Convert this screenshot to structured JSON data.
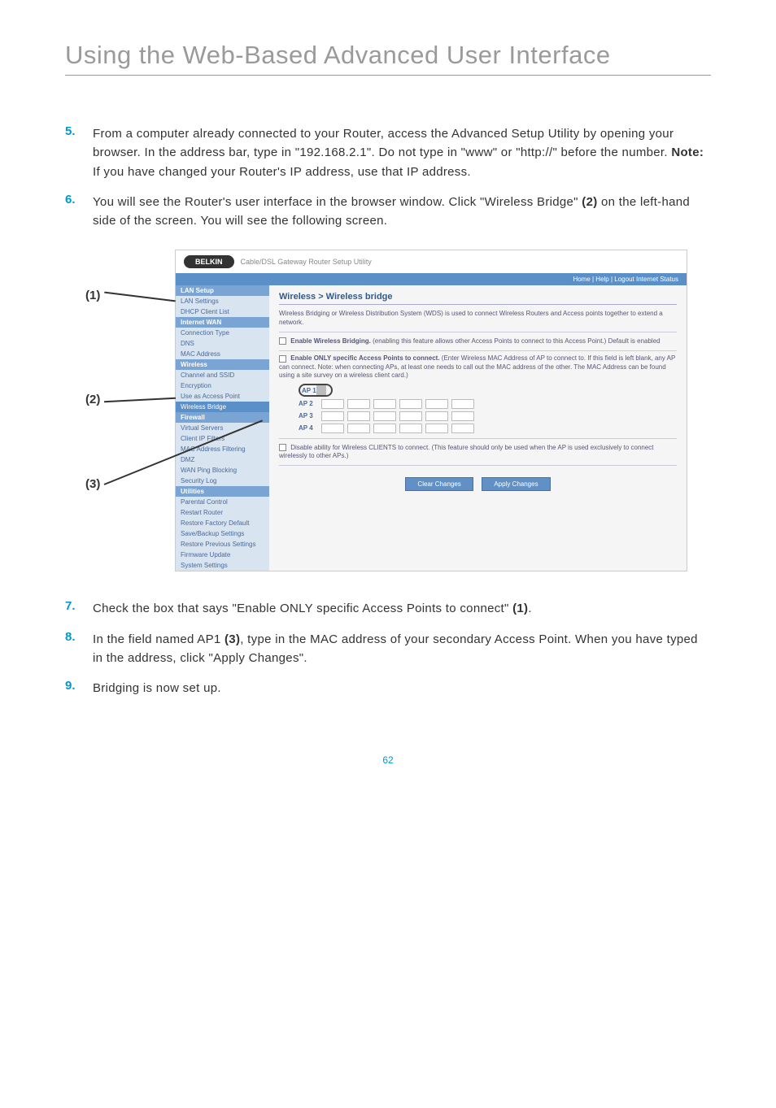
{
  "header": {
    "title": "Using the Web-Based Advanced User Interface"
  },
  "callouts": {
    "c1": "(1)",
    "c2": "(2)",
    "c3": "(3)"
  },
  "steps": {
    "s5": {
      "num": "5.",
      "text_a": "From a computer already connected to your Router, access the Advanced Setup Utility by opening your browser. In the address bar, type in \"192.168.2.1\". Do not type in \"www\" or \"http://\" before the number. ",
      "bold": "Note:",
      "text_b": " If you have changed your Router's IP address, use that IP address."
    },
    "s6": {
      "num": "6.",
      "text_a": "You will see the Router's user interface in the browser window. Click \"Wireless Bridge\" ",
      "bold": "(2)",
      "text_b": " on the left-hand side of the screen. You will see the following screen."
    },
    "s7": {
      "num": "7.",
      "text_a": "Check the box that says \"Enable ONLY specific Access Points to connect\" ",
      "bold": "(1)",
      "text_b": "."
    },
    "s8": {
      "num": "8.",
      "text_a": "In the field named AP1 ",
      "bold": "(3)",
      "text_b": ", type in the MAC address of your secondary Access Point. When you have typed in the address, click \"Apply Changes\"."
    },
    "s9": {
      "num": "9.",
      "text": "Bridging is now set up."
    }
  },
  "router": {
    "logo": "BELKIN",
    "subtitle": "Cable/DSL Gateway Router Setup Utility",
    "topbar": "Home | Help | Logout   Internet Status",
    "sidebar": {
      "h1": "LAN Setup",
      "i1": "LAN Settings",
      "i2": "DHCP Client List",
      "h2": "Internet WAN",
      "i3": "Connection Type",
      "i4": "DNS",
      "i5": "MAC Address",
      "h3": "Wireless",
      "i6": "Channel and SSID",
      "i7": "Encryption",
      "i8": "Use as Access Point",
      "i9": "Wireless Bridge",
      "h4": "Firewall",
      "i10": "Virtual Servers",
      "i11": "Client IP Filters",
      "i12": "MAC Address Filtering",
      "i13": "DMZ",
      "i14": "WAN Ping Blocking",
      "i15": "Security Log",
      "h5": "Utilities",
      "i16": "Parental Control",
      "i17": "Restart Router",
      "i18": "Restore Factory Default",
      "i19": "Save/Backup Settings",
      "i20": "Restore Previous Settings",
      "i21": "Firmware Update",
      "i22": "System Settings"
    },
    "content": {
      "title": "Wireless > Wireless bridge",
      "intro": "Wireless Bridging or Wireless Distribution System (WDS) is used to connect Wireless Routers and Access points together to extend a network.",
      "check1_bold": "Enable Wireless Bridging.",
      "check1_rest": " (enabling this feature allows other Access Points to connect to this Access Point.) Default is enabled",
      "check2_bold": "Enable ONLY specific Access Points to connect.",
      "check2_rest": " (Enter Wireless MAC Address of AP to connect to. If this field is left blank, any AP can connect. Note: when connecting APs, at least one needs to call out the MAC address of the other. The MAC Address can be found using a site survey on a wireless client card.)",
      "ap1": "AP 1",
      "ap2": "AP 2",
      "ap3": "AP 3",
      "ap4": "AP 4",
      "check3": "Disable ability for Wireless CLIENTS to connect. (This feature should only be used when the AP is used exclusively to connect wirelessly to other APs.)",
      "btn_clear": "Clear Changes",
      "btn_apply": "Apply Changes"
    }
  },
  "page_number": "62"
}
